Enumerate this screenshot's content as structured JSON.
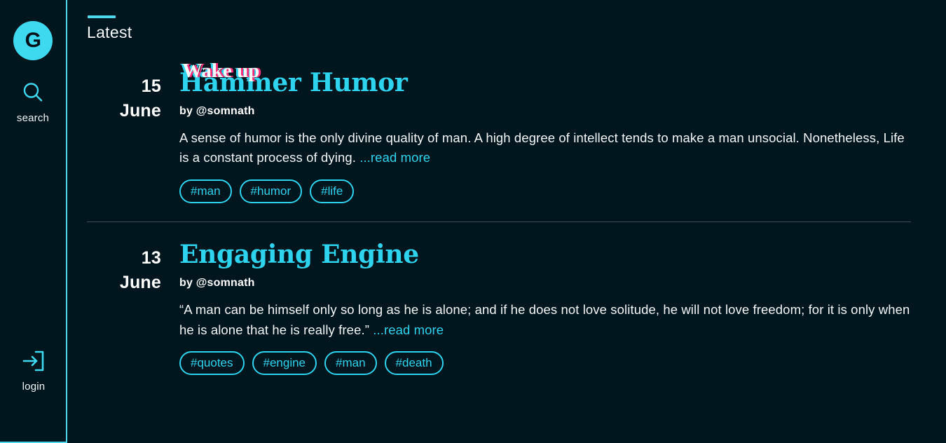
{
  "colors": {
    "background": "#00161f",
    "accent": "#2ed3ee",
    "accent_bright": "#4fd8ec",
    "glitch_pink": "#ff2d78",
    "text": "#f3f7f8",
    "divider": "#3d5059",
    "logo_text": "#001018"
  },
  "sidebar": {
    "logo_letter": "G",
    "items": [
      {
        "icon": "search-icon",
        "label": "search"
      },
      {
        "icon": "login-icon",
        "label": "login"
      }
    ]
  },
  "main": {
    "section": {
      "title": "Latest"
    },
    "posts": [
      {
        "day": "15",
        "month": "June",
        "title": "Hammer Humor",
        "glitch_title": "Wake up",
        "author": "by @somnath",
        "excerpt": "A sense of humor is the only divine quality of man. A high degree of intellect tends to make a man unsocial. Nonetheless, Life is a constant process of dying. ",
        "read_more": "...read more",
        "tags": [
          "#man",
          "#humor",
          "#life"
        ]
      },
      {
        "day": "13",
        "month": "June",
        "title": "Engaging Engine",
        "glitch_title": "",
        "author": "by @somnath",
        "excerpt": "“A man can be himself only so long as he is alone; and if he does not love solitude, he will not love freedom; for it is only when he is alone that he is really free.” ",
        "read_more": "...read more",
        "tags": [
          "#quotes",
          "#engine",
          "#man",
          "#death"
        ]
      }
    ]
  }
}
